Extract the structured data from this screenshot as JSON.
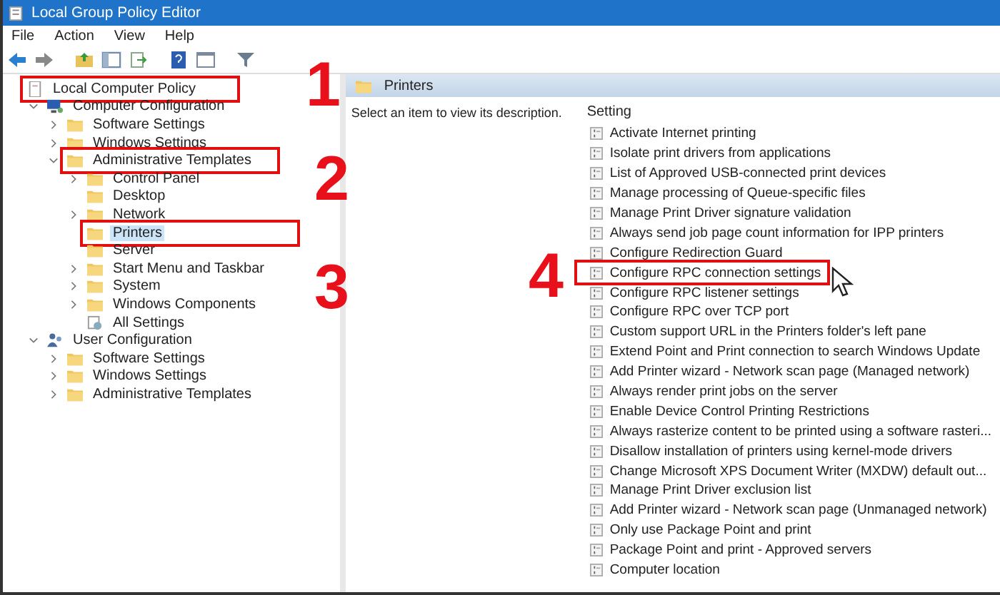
{
  "window": {
    "title": "Local Group Policy Editor"
  },
  "menu": [
    "File",
    "Action",
    "View",
    "Help"
  ],
  "tree": [
    {
      "label": "Local Computer Policy",
      "kind": "policy",
      "marked": true,
      "selected": false,
      "children": [
        {
          "label": "Computer Configuration",
          "kind": "computer",
          "expanded": true,
          "marked": false,
          "selected": false,
          "children": [
            {
              "label": "Software Settings",
              "kind": "folder",
              "expanded": false,
              "marked": false,
              "selected": false
            },
            {
              "label": "Windows Settings",
              "kind": "folder",
              "expanded": false,
              "marked": false,
              "selected": false
            },
            {
              "label": "Administrative Templates",
              "kind": "folder",
              "expanded": true,
              "marked": true,
              "selected": false,
              "children": [
                {
                  "label": "Control Panel",
                  "kind": "folder",
                  "expanded": false,
                  "marked": false,
                  "selected": false
                },
                {
                  "label": "Desktop",
                  "kind": "folder",
                  "marked": false,
                  "selected": false
                },
                {
                  "label": "Network",
                  "kind": "folder",
                  "expanded": false,
                  "marked": false,
                  "selected": false
                },
                {
                  "label": "Printers",
                  "kind": "folder",
                  "marked": true,
                  "selected": true
                },
                {
                  "label": "Server",
                  "kind": "folder",
                  "marked": false,
                  "selected": false
                },
                {
                  "label": "Start Menu and Taskbar",
                  "kind": "folder",
                  "expanded": false,
                  "marked": false,
                  "selected": false
                },
                {
                  "label": "System",
                  "kind": "folder",
                  "expanded": false,
                  "marked": false,
                  "selected": false
                },
                {
                  "label": "Windows Components",
                  "kind": "folder",
                  "expanded": false,
                  "marked": false,
                  "selected": false
                },
                {
                  "label": "All Settings",
                  "kind": "settings",
                  "marked": false,
                  "selected": false
                }
              ]
            }
          ]
        },
        {
          "label": "User Configuration",
          "kind": "user",
          "expanded": true,
          "marked": false,
          "selected": false,
          "children": [
            {
              "label": "Software Settings",
              "kind": "folder",
              "expanded": false,
              "marked": false,
              "selected": false
            },
            {
              "label": "Windows Settings",
              "kind": "folder",
              "expanded": false,
              "marked": false,
              "selected": false
            },
            {
              "label": "Administrative Templates",
              "kind": "folder",
              "expanded": false,
              "marked": false,
              "selected": false
            }
          ]
        }
      ]
    }
  ],
  "pane": {
    "title": "Printers",
    "description": "Select an item to view its description.",
    "column": "Setting",
    "settings": [
      {
        "label": "Activate Internet printing",
        "marked": false
      },
      {
        "label": "Isolate print drivers from applications",
        "marked": false
      },
      {
        "label": "List of Approved USB-connected print devices",
        "marked": false
      },
      {
        "label": "Manage processing of Queue-specific files",
        "marked": false
      },
      {
        "label": "Manage Print Driver signature validation",
        "marked": false
      },
      {
        "label": "Always send job page count information for IPP printers",
        "marked": false
      },
      {
        "label": "Configure Redirection Guard",
        "marked": false
      },
      {
        "label": "Configure RPC connection settings",
        "marked": true
      },
      {
        "label": "Configure RPC listener settings",
        "marked": false
      },
      {
        "label": "Configure RPC over TCP port",
        "marked": false
      },
      {
        "label": "Custom support URL in the Printers folder's left pane",
        "marked": false
      },
      {
        "label": "Extend Point and Print connection to search Windows Update",
        "marked": false
      },
      {
        "label": "Add Printer wizard - Network scan page (Managed network)",
        "marked": false
      },
      {
        "label": "Always render print jobs on the server",
        "marked": false
      },
      {
        "label": "Enable Device Control Printing Restrictions",
        "marked": false
      },
      {
        "label": "Always rasterize content to be printed using a software rasteri...",
        "marked": false
      },
      {
        "label": "Disallow installation of printers using kernel-mode drivers",
        "marked": false
      },
      {
        "label": "Change Microsoft XPS Document Writer (MXDW) default out...",
        "marked": false
      },
      {
        "label": "Manage Print Driver exclusion list",
        "marked": false
      },
      {
        "label": "Add Printer wizard - Network scan page (Unmanaged network)",
        "marked": false
      },
      {
        "label": "Only use Package Point and print",
        "marked": false
      },
      {
        "label": "Package Point and print - Approved servers",
        "marked": false
      },
      {
        "label": "Computer location",
        "marked": false
      }
    ]
  },
  "annotations": [
    "1",
    "2",
    "3",
    "4"
  ]
}
